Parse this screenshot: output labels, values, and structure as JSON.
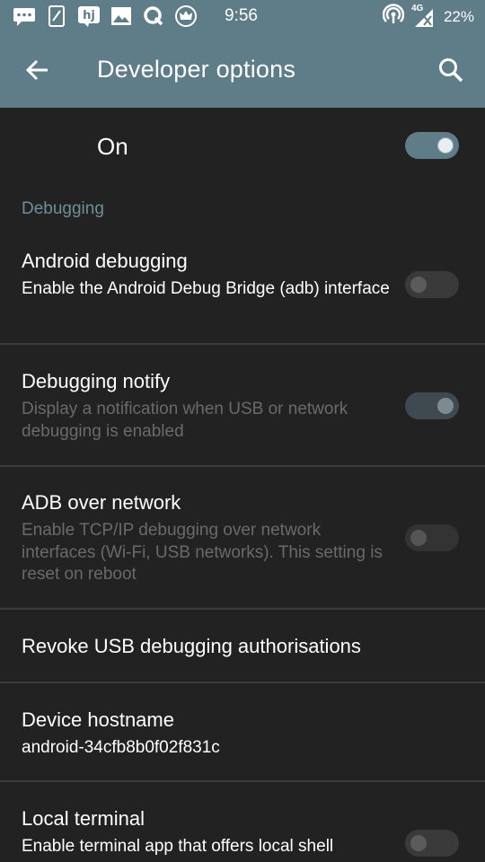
{
  "status_bar": {
    "time": "9:56",
    "network": "4G",
    "battery": "22%",
    "left_icons": [
      "chat-bubble-icon",
      "phone-edit-icon",
      "hj-app-icon",
      "image-icon",
      "q-app-icon",
      "crown-app-icon"
    ],
    "right_icons": [
      "hotspot-icon",
      "signal-icon"
    ]
  },
  "toolbar": {
    "title": "Developer options",
    "back_icon": "arrow-back-icon",
    "search_icon": "search-icon"
  },
  "master_switch": {
    "label": "On",
    "state": "on"
  },
  "section": {
    "title": "Debugging"
  },
  "settings": [
    {
      "title": "Android debugging",
      "subtitle": "Enable the Android Debug Bridge (adb) interface",
      "toggle": "off",
      "enabled": true
    },
    {
      "title": "Debugging notify",
      "subtitle": "Display a notification when USB or network debugging is enabled",
      "toggle": "on",
      "enabled": false
    },
    {
      "title": "ADB over network",
      "subtitle": "Enable TCP/IP debugging over network interfaces (Wi-Fi, USB networks). This setting is reset on reboot",
      "toggle": "off",
      "enabled": false
    },
    {
      "title": "Revoke USB debugging authorisations",
      "enabled": true
    },
    {
      "title": "Device hostname",
      "subtitle": "android-34cfb8b0f02f831c",
      "enabled": true
    },
    {
      "title": "Local terminal",
      "subtitle": "Enable terminal app that offers local shell",
      "toggle": "off",
      "enabled": true
    }
  ],
  "colors": {
    "accent": "#5f7d89",
    "background": "#222222",
    "section_header": "#6f8e9a",
    "disabled_text": "#6a6a6a"
  }
}
